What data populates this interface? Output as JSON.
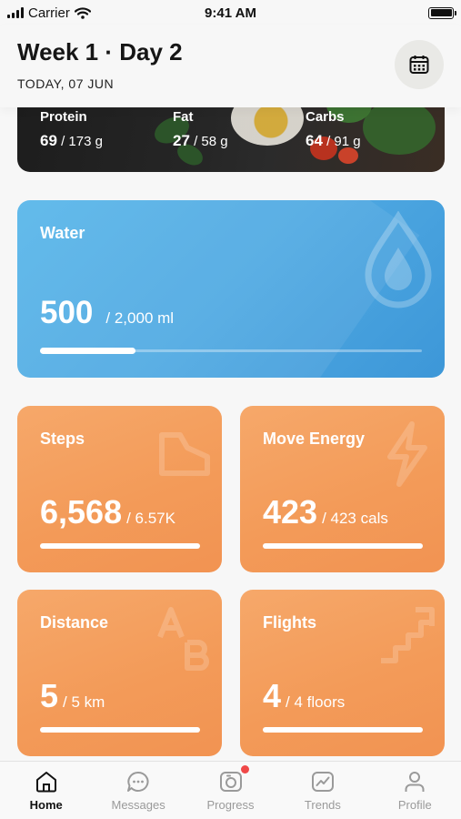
{
  "status_bar": {
    "carrier": "Carrier",
    "time": "9:41 AM"
  },
  "header": {
    "title": "Week 1 · Day 2",
    "subtitle": "TODAY, 07 JUN",
    "calendar_icon": "calendar-icon"
  },
  "macros": [
    {
      "label": "Protein",
      "value": "69",
      "target": " / 173 g"
    },
    {
      "label": "Fat",
      "value": "27",
      "target": " / 58 g"
    },
    {
      "label": "Carbs",
      "value": "64",
      "target": " / 91 g"
    }
  ],
  "water": {
    "label": "Water",
    "value": "500",
    "target": "/  2,000 ml",
    "progress": 0.25,
    "icon": "water-drop-icon"
  },
  "tiles": [
    {
      "label": "Steps",
      "value": "6,568",
      "target": "/ 6.57K",
      "progress": 1.0,
      "icon": "shoe-icon"
    },
    {
      "label": "Move Energy",
      "value": "423",
      "target": "/ 423 cals",
      "progress": 1.0,
      "icon": "lightning-icon"
    },
    {
      "label": "Distance",
      "value": "5",
      "target": "/ 5 km",
      "progress": 1.0,
      "icon": "a-to-b-icon"
    },
    {
      "label": "Flights",
      "value": "4",
      "target": "/ 4 floors",
      "progress": 1.0,
      "icon": "stairs-icon"
    }
  ],
  "tabbar": [
    {
      "label": "Home",
      "icon": "home-icon",
      "active": true
    },
    {
      "label": "Messages",
      "icon": "chat-icon",
      "active": false
    },
    {
      "label": "Progress",
      "icon": "camera-icon",
      "active": false,
      "badge": true
    },
    {
      "label": "Trends",
      "icon": "trend-icon",
      "active": false
    },
    {
      "label": "Profile",
      "icon": "profile-icon",
      "active": false
    }
  ],
  "colors": {
    "water_card": "#4fa9e2",
    "tile_orange": "#f39b59",
    "badge_red": "#f04848"
  }
}
